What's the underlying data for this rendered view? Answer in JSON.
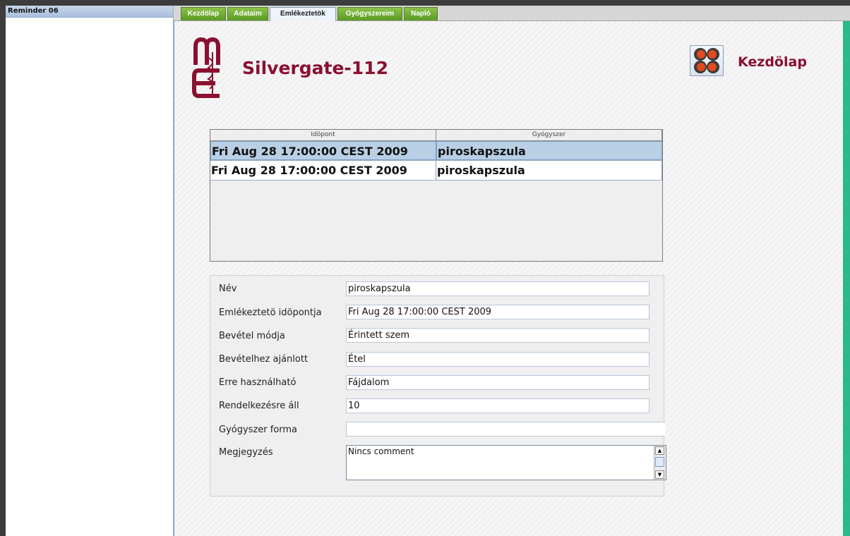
{
  "window": {
    "title": "Reminder 06"
  },
  "tabs": [
    {
      "label": "Kezdölap",
      "active": false
    },
    {
      "label": "Adataim",
      "active": false
    },
    {
      "label": "Emlékeztetök",
      "active": true
    },
    {
      "label": "Gyógyszereim",
      "active": false
    },
    {
      "label": "Napló",
      "active": false
    }
  ],
  "header": {
    "app_title": "Silvergate-112",
    "home_label": "Kezdölap",
    "logo_icon": "caduceus-logo-icon",
    "home_icon": "four-leaf-home-icon"
  },
  "table": {
    "columns": [
      "Idöpont",
      "Gyógyszer"
    ],
    "rows": [
      {
        "time": "Fri Aug 28 17:00:00 CEST 2009",
        "drug": "piroskapszula",
        "selected": true
      },
      {
        "time": "Fri Aug 28 17:00:00 CEST 2009",
        "drug": "piroskapszula",
        "selected": false
      }
    ]
  },
  "form": {
    "fields": [
      {
        "label": "Név",
        "value": "piroskapszula"
      },
      {
        "label": "Emlékeztetö idöpontja",
        "value": "Fri Aug 28 17:00:00 CEST 2009"
      },
      {
        "label": "Bevétel módja",
        "value": "Érintett szem"
      },
      {
        "label": "Bevételhez ajánlott",
        "value": "Étel"
      },
      {
        "label": "Erre használható",
        "value": "Fájdalom"
      },
      {
        "label": "Rendelkezésre áll",
        "value": "10"
      },
      {
        "label": "Gyógyszer forma",
        "value": ""
      }
    ],
    "notes": {
      "label": "Megjegyzés",
      "value": "Nincs comment"
    }
  },
  "colors": {
    "brand": "#8a1030",
    "tab_green": "#5a9a23",
    "selection": "#b9cfe5",
    "side_accent": "#29b98b"
  }
}
